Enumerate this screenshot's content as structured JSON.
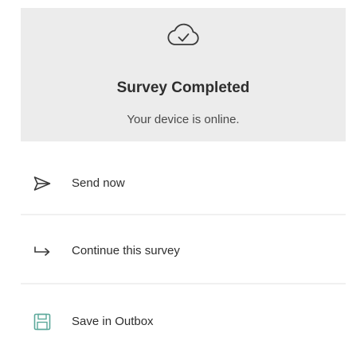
{
  "header": {
    "icon": "cloud-check-icon",
    "title": "Survey Completed",
    "subtitle": "Your device is online."
  },
  "actions": [
    {
      "icon": "send-icon",
      "label": "Send now"
    },
    {
      "icon": "arrow-continue-icon",
      "label": "Continue this survey"
    },
    {
      "icon": "save-floppy-icon",
      "label": "Save in Outbox"
    }
  ],
  "colors": {
    "header_bg": "#ececec",
    "text": "#2e2e2e",
    "save_icon": "#5aa89a"
  }
}
